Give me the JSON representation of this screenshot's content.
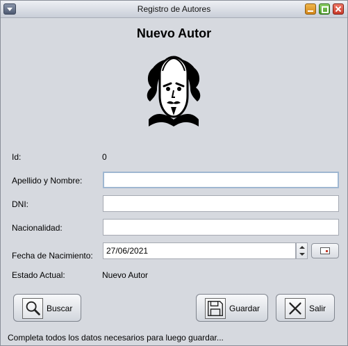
{
  "window": {
    "title": "Registro de Autores"
  },
  "heading": "Nuevo Autor",
  "fields": {
    "id_label": "Id:",
    "id_value": "0",
    "nombre_label": "Apellido y Nombre:",
    "nombre_value": "",
    "dni_label": "DNI:",
    "dni_value": "",
    "nacionalidad_label": "Nacionalidad:",
    "nacionalidad_value": "",
    "fecha_label": "Fecha de Nacimiento:",
    "fecha_value": "27/06/2021",
    "estado_label": "Estado Actual:",
    "estado_value": "Nuevo Autor"
  },
  "buttons": {
    "buscar": "Buscar",
    "guardar": "Guardar",
    "salir": "Salir"
  },
  "status_text": "Completa todos los datos necesarios para luego guardar...",
  "icons": [
    "window-menu-icon",
    "minimize-icon",
    "maximize-icon",
    "close-icon",
    "author-portrait-icon",
    "spinner-up-icon",
    "spinner-down-icon",
    "calendar-icon",
    "magnifier-icon",
    "floppy-disk-icon",
    "exit-x-icon"
  ]
}
